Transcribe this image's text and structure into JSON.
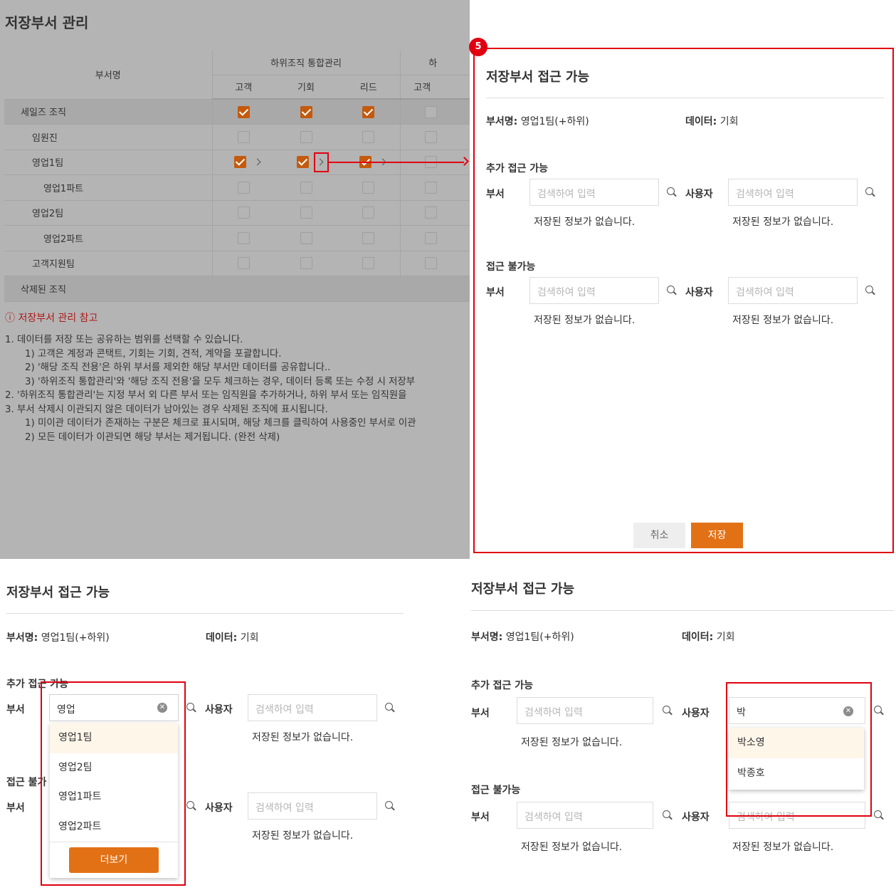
{
  "page": {
    "title": "저장부서 관리"
  },
  "table": {
    "header": {
      "dept": "부서명",
      "group1": "하위조직 통합관리",
      "group2_partial": "하",
      "cols": [
        "고객",
        "기회",
        "리드",
        "고객"
      ]
    },
    "rows": [
      {
        "name": "세일즈 조직",
        "indent": 0,
        "checks": [
          true,
          true,
          true,
          false
        ],
        "arrows": false,
        "group": true
      },
      {
        "name": "임원진",
        "indent": 1,
        "checks": [
          false,
          false,
          false,
          false
        ],
        "arrows": false,
        "group": false
      },
      {
        "name": "영업1팀",
        "indent": 1,
        "checks": [
          true,
          true,
          true,
          false
        ],
        "arrows": true,
        "group": false
      },
      {
        "name": "영업1파트",
        "indent": 2,
        "checks": [
          false,
          false,
          false,
          false
        ],
        "arrows": false,
        "group": false
      },
      {
        "name": "영업2팀",
        "indent": 1,
        "checks": [
          false,
          false,
          false,
          false
        ],
        "arrows": false,
        "group": false
      },
      {
        "name": "영업2파트",
        "indent": 2,
        "checks": [
          false,
          false,
          false,
          false
        ],
        "arrows": false,
        "group": false
      },
      {
        "name": "고객지원팀",
        "indent": 1,
        "checks": [
          false,
          false,
          false,
          false
        ],
        "arrows": false,
        "group": false
      },
      {
        "name": "삭제된 조직",
        "indent": 0,
        "checks": null,
        "arrows": false,
        "group": true
      }
    ]
  },
  "notes": {
    "title": "ⓘ 저장부서 관리 참고",
    "lines": [
      {
        "text": "1. 데이터를 저장 또는 공유하는 범위를 선택할 수 있습니다.",
        "indent": 0
      },
      {
        "text": "1) 고객은 계정과 콘택트, 기회는 기회, 견적, 계약을 포괄합니다.",
        "indent": 1
      },
      {
        "text": "2) '해당 조직 전용'은 하위 부서를 제외한 해당 부서만 데이터를 공유합니다..",
        "indent": 1
      },
      {
        "text": "3) '하위조직 통합관리'와 '해당 조직 전용'을 모두 체크하는 경우, 데이터 등록 또는 수정 시 저장부",
        "indent": 1
      },
      {
        "text": "2. '하위조직 통합관리'는 지정 부서 외 다른 부서 또는 임직원을 추가하거나, 하위 부서 또는 임직원을",
        "indent": 0
      },
      {
        "text": "3. 부서 삭제시 이관되지 않은 데이터가 남아있는 경우 삭제된 조직에 표시됩니다.",
        "indent": 0
      },
      {
        "text": "1) 미이관 데이터가 존재하는 구분은 체크로 표시되며, 해당 체크를 클릭하여 사용중인 부서로 이관",
        "indent": 1
      },
      {
        "text": "2) 모든 데이터가 이관되면 해당 부서는 제거됩니다. (완전 삭제)",
        "indent": 1
      }
    ]
  },
  "step_badge": "5",
  "modal": {
    "title": "저장부서 접근 가능",
    "dept_label": "부서명:",
    "dept_value": "영업1팀(+하위)",
    "data_label": "데이터:",
    "data_value": "기회",
    "allow_section": "추가 접근 가능",
    "deny_section": "접근 불가능",
    "dept_field_label": "부서",
    "user_field_label": "사용자",
    "placeholder": "검색하여 입력",
    "empty_text": "저장된 정보가 없습니다.",
    "cancel": "취소",
    "save": "저장"
  },
  "example_dept_search": {
    "title": "저장부서 접근 가능",
    "query": "영업",
    "options": [
      "영업1팀",
      "영업2팀",
      "영업1파트",
      "영업2파트"
    ],
    "more": "더보기",
    "allow_section_partial": "추가 접근 가능",
    "deny_section_partial": "접근 불가"
  },
  "example_user_search": {
    "title": "저장부서 접근 가능",
    "query": "박",
    "options": [
      "박소영",
      "박종호"
    ]
  },
  "colors": {
    "accent": "#e27116",
    "highlight": "#e00010",
    "overlay": "#b4b4b4"
  }
}
